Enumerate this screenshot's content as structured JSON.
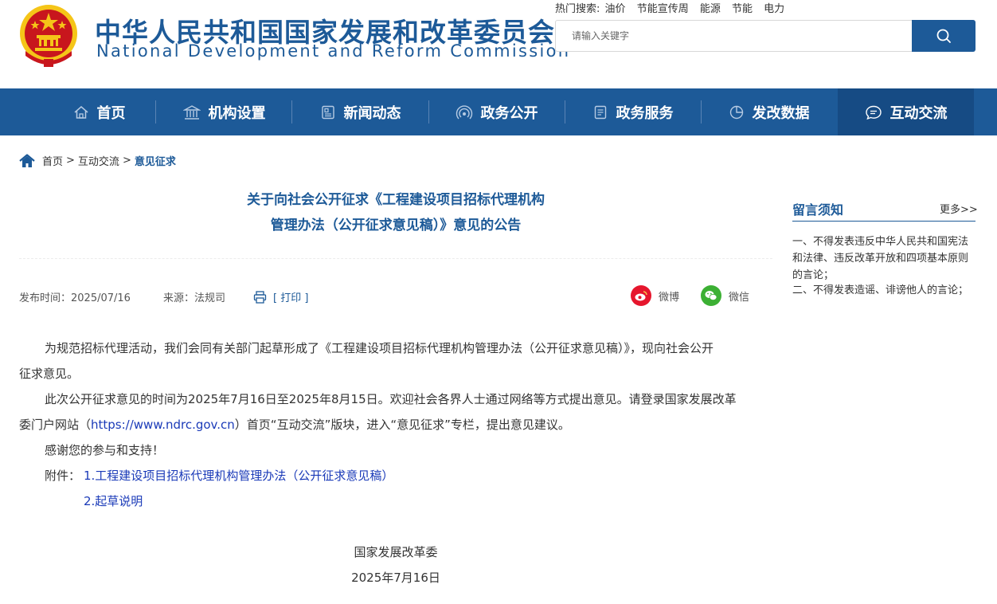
{
  "header": {
    "title_cn": "中华人民共和国国家发展和改革委员会",
    "title_en": "National Development and Reform Commission",
    "hot_search_label": "热门搜索:",
    "hot_search_items": [
      "油价",
      "节能宣传周",
      "能源",
      "节能",
      "电力"
    ],
    "search_placeholder": "请输入关键字",
    "emblem_icon": "national-emblem-icon",
    "search_icon": "search-icon"
  },
  "nav": {
    "items": [
      {
        "label": "首页",
        "icon": "home-icon"
      },
      {
        "label": "机构设置",
        "icon": "institution-icon"
      },
      {
        "label": "新闻动态",
        "icon": "news-icon"
      },
      {
        "label": "政务公开",
        "icon": "broadcast-icon"
      },
      {
        "label": "政务服务",
        "icon": "document-icon"
      },
      {
        "label": "发改数据",
        "icon": "pie-chart-icon"
      },
      {
        "label": "互动交流",
        "icon": "chat-icon"
      }
    ],
    "active_index": 6
  },
  "breadcrumb": {
    "home": "首页",
    "level2": "互动交流",
    "current": "意见征求",
    "separator": ">"
  },
  "article": {
    "title_line1": "关于向社会公开征求《工程建设项目招标代理机构",
    "title_line2": "管理办法（公开征求意见稿）》意见的公告",
    "publish_time": "发布时间：2025/07/16",
    "source": "来源：法规司",
    "print_label": "[ 打印 ]",
    "share_weibo": "微博",
    "share_wechat": "微信",
    "para1_line1": "为规范招标代理活动，我们会同有关部门起草形成了《工程建设项目招标代理机构管理办法（公开征求意见稿）》，现向社会公开",
    "para1_line2": "征求意见。",
    "para2_line1": "此次公开征求意见的时间为2025年7月16日至2025年8月15日。欢迎社会各界人士通过网络等方式提出意见。请登录国家发展改革",
    "para2_line2_a": "委门户网站（",
    "para2_url": "https://www.ndrc.gov.cn",
    "para2_line2_b": "）首页“互动交流”版块，进入“意见征求”专栏，提出意见建议。",
    "para3": "感谢您的参与和支持！",
    "attachment_label": "附件：",
    "attachments": [
      "1.工程建设项目招标代理机构管理办法（公开征求意见稿）",
      "2.起草说明"
    ],
    "signature_org": "国家发展改革委",
    "signature_date": "2025年7月16日"
  },
  "sidebar": {
    "title": "留言须知",
    "more": "更多>>",
    "rule1": "一、不得发表违反中华人民共和国宪法和法律、违反改革开放和四项基本原则的言论；",
    "rule2": "二、不得发表造谣、诽谤他人的言论；"
  },
  "colors": {
    "brand_blue": "#1d5a98",
    "nav_active": "#164b84",
    "link_blue": "#1a3ab8",
    "weibo_red": "#e6162d",
    "wechat_green": "#3cb034",
    "emblem_red": "#c8161d",
    "emblem_gold": "#f5c518"
  }
}
